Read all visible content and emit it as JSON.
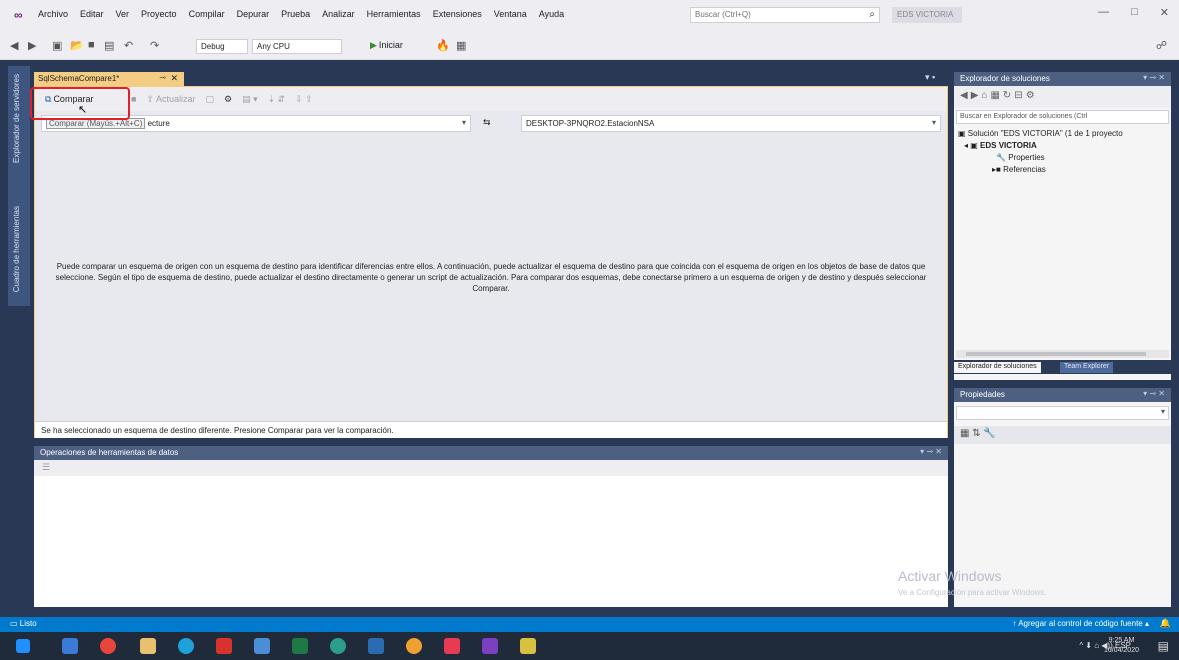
{
  "menubar": {
    "items": [
      "Archivo",
      "Editar",
      "Ver",
      "Proyecto",
      "Compilar",
      "Depurar",
      "Prueba",
      "Analizar",
      "Herramientas",
      "Extensiones",
      "Ventana",
      "Ayuda"
    ],
    "search_placeholder": "Buscar (Ctrl+Q)",
    "solution_badge": "EDS VICTORIA"
  },
  "toolbar": {
    "config": "Debug",
    "platform": "Any CPU",
    "start": "Iniciar"
  },
  "left_rail": {
    "items": [
      "Explorador de servidores",
      "Cuadro de herramientas"
    ]
  },
  "document": {
    "tab_title": "SqlSchemaCompare1*",
    "compare_label": "Comparar",
    "update_label": "Actualizar",
    "source_value": "Comparar (Mayús.+Alt+C)",
    "source_tail": "ecture",
    "target_value": "DESKTOP-3PNQRO2.EstacionNSA",
    "info_text": "Puede comparar un esquema de origen con un esquema de destino para identificar diferencias entre ellos. A continuación, puede actualizar el esquema de destino para que coincida con el esquema de origen en los objetos de base de datos que seleccione. Según el tipo de esquema de destino, puede actualizar el destino directamente o generar un script de actualización. Para comparar dos esquemas, debe conectarse primero a un esquema de origen y de destino y después seleccionar Comparar.",
    "status_text": "Se ha seleccionado un esquema de destino diferente. Presione Comparar para ver la comparación."
  },
  "ops_panel": {
    "title": "Operaciones de herramientas de datos"
  },
  "solution_explorer": {
    "title": "Explorador de soluciones",
    "search_placeholder": "Buscar en Explorador de soluciones (Ctrl",
    "tree": {
      "solution": "Solución \"EDS VICTORIA\" (1 de 1 proyecto",
      "project": "EDS VICTORIA",
      "properties": "Properties",
      "references": "Referencias"
    },
    "tab_active": "Explorador de soluciones",
    "tab_inactive": "Team Explorer"
  },
  "properties": {
    "title": "Propiedades"
  },
  "watermark": {
    "title": "Activar Windows",
    "subtitle": "Ve a Configuración para activar Windows."
  },
  "statusbar": {
    "left": "Listo",
    "right": "Agregar al control de código fuente"
  },
  "taskbar": {
    "lang": "ESP",
    "time": "9:25 AM",
    "date": "16/04/2020"
  }
}
